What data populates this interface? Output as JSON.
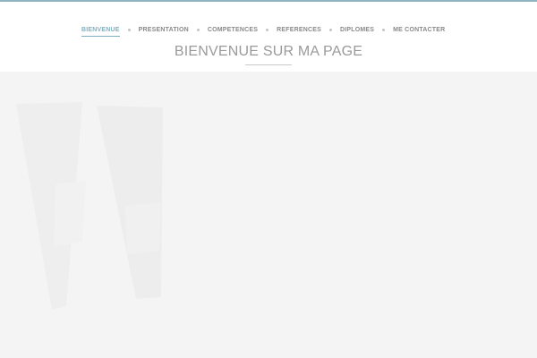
{
  "nav": {
    "items": [
      {
        "label": "BIENVENUE",
        "active": true
      },
      {
        "label": "PRESENTATION",
        "active": false
      },
      {
        "label": "COMPETENCES",
        "active": false
      },
      {
        "label": "REFERENCES",
        "active": false
      },
      {
        "label": "DIPLOMES",
        "active": false
      },
      {
        "label": "ME CONTACTER",
        "active": false
      }
    ]
  },
  "page": {
    "title": "BIENVENUE SUR MA PAGE"
  },
  "colors": {
    "accent": "#7fb0bf",
    "top_bar": "#8fb4bf",
    "nav_text": "#8a8a8a",
    "title_text": "#9a9a9a",
    "background": "#f4f4f4"
  }
}
